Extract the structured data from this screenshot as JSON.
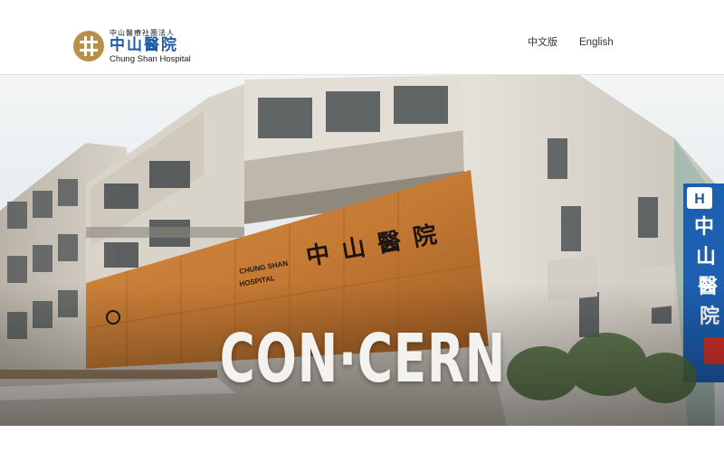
{
  "header": {
    "logo": {
      "org_line": "中山醫療社團法人",
      "name_zh": "中山醫院",
      "name_en": "Chung Shan Hospital"
    },
    "nav": {
      "lang_zh": "中文版",
      "lang_en": "English"
    }
  },
  "hero": {
    "title": "CON·CERN",
    "facade_sign_zh": "中山醫院",
    "facade_sign_en_line1": "CHUNG SHAN",
    "facade_sign_en_line2": "HOSPITAL",
    "vertical_sign": {
      "badge": "H",
      "chars": [
        "中",
        "山",
        "醫",
        "院"
      ]
    }
  },
  "colors": {
    "brand_blue": "#1f5aa6",
    "logo_gold": "#b89049",
    "facade_orange": "#c57a34",
    "sign_blue": "#1d5fb0"
  }
}
